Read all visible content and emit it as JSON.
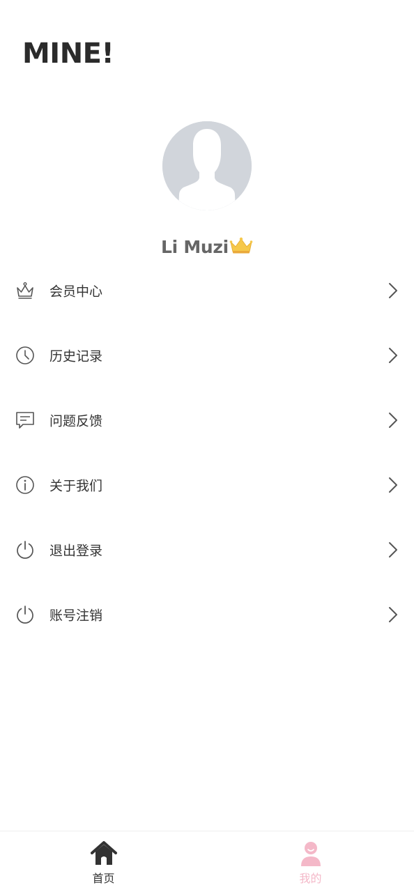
{
  "header": {
    "title": "MINE!"
  },
  "profile": {
    "name": "Li Muzi",
    "badge_icon": "crown-icon"
  },
  "menu": [
    {
      "key": "membership",
      "label": "会员中心",
      "icon": "crown-outline-icon"
    },
    {
      "key": "history",
      "label": "历史记录",
      "icon": "clock-icon"
    },
    {
      "key": "feedback",
      "label": "问题反馈",
      "icon": "chat-icon"
    },
    {
      "key": "about",
      "label": "关于我们",
      "icon": "info-icon"
    },
    {
      "key": "logout",
      "label": "退出登录",
      "icon": "power-icon"
    },
    {
      "key": "delete_account",
      "label": "账号注销",
      "icon": "power-icon"
    }
  ],
  "tabbar": {
    "home_label": "首页",
    "mine_label": "我的",
    "active": "mine",
    "active_color": "#f4b8c8",
    "inactive_color": "#333333"
  }
}
